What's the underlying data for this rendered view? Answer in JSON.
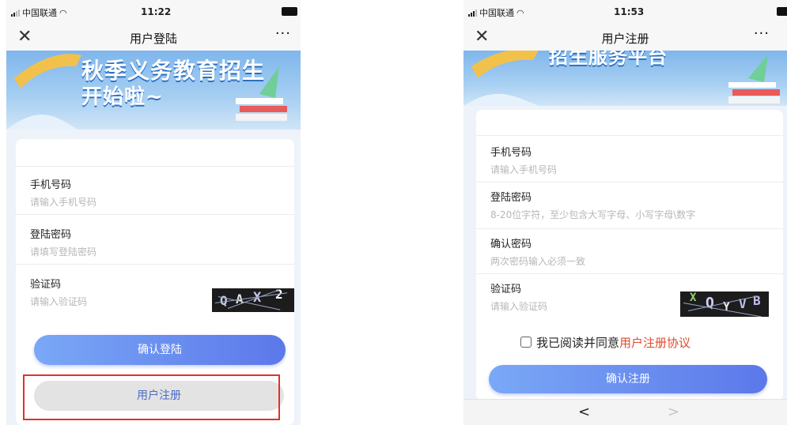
{
  "left": {
    "status": {
      "carrier": "中国联通",
      "time": "11:22"
    },
    "nav": {
      "close": "✕",
      "title": "用户登陆",
      "more": "···"
    },
    "banner": {
      "line1": "秋季义务教育招生",
      "line2": "开始啦~"
    },
    "fields": [
      {
        "label": "手机号码",
        "placeholder": "请输入手机号码"
      },
      {
        "label": "登陆密码",
        "placeholder": "请填写登陆密码"
      },
      {
        "label": "验证码",
        "placeholder": "请输入验证码"
      }
    ],
    "captcha": "QAX2",
    "primary_button": "确认登陆",
    "secondary_button": "用户注册"
  },
  "right": {
    "status": {
      "carrier": "中国联通",
      "time": "11:53"
    },
    "nav": {
      "close": "✕",
      "title": "用户注册",
      "more": "···"
    },
    "banner": {
      "line1": "招生服务平台"
    },
    "fields": [
      {
        "label": "手机号码",
        "placeholder": "请输入手机号码"
      },
      {
        "label": "登陆密码",
        "placeholder": "8-20位字符，至少包含大写字母、小写字母\\数字"
      },
      {
        "label": "确认密码",
        "placeholder": "两次密码输入必须一致"
      },
      {
        "label": "验证码",
        "placeholder": "请输入验证码"
      }
    ],
    "captcha": "XQYVB",
    "agreement": {
      "text": "我已阅读并同意",
      "link": "用户注册协议"
    },
    "primary_button": "确认注册",
    "toolbar": {
      "back": "<",
      "forward": ">"
    }
  },
  "colors": {
    "primary_gradient": [
      "#7aa8f6",
      "#5c78ea"
    ],
    "highlight_box": "#e0322b",
    "agreement_link": "#e34a2c",
    "banner_sky": "#8fc0ee"
  }
}
